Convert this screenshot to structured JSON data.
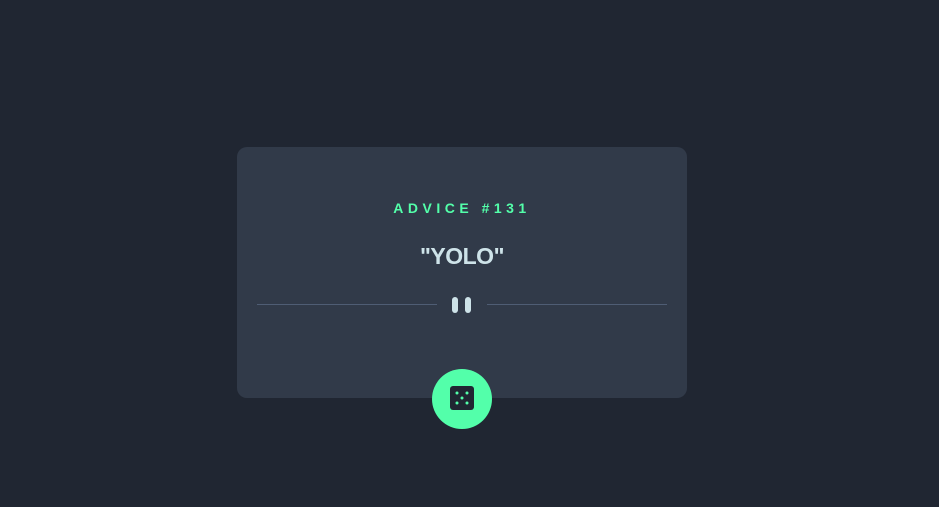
{
  "advice": {
    "label": "ADVICE #131",
    "quote": "\"YOLO\""
  },
  "divider": {
    "icon": "pause-icon"
  },
  "button": {
    "icon": "dice-icon"
  },
  "colors": {
    "background": "#202632",
    "card": "#313a49",
    "accent": "#53ffaa",
    "text": "#cee3e9",
    "divider": "#4f5d74"
  }
}
